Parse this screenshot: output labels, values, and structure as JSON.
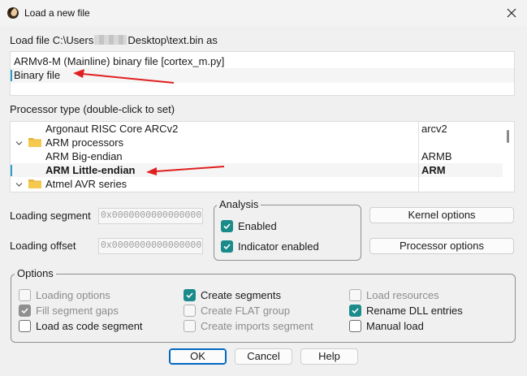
{
  "window": {
    "title": "Load a new file",
    "close_icon": "close-icon",
    "app_icon": "ida-app-icon"
  },
  "load_file": {
    "label_prefix": "Load file C:\\Users",
    "label_suffix": "Desktop\\text.bin as"
  },
  "file_types": [
    {
      "label": "ARMv8-M (Mainline) binary file [cortex_m.py]"
    },
    {
      "label": "Binary file",
      "selected": true
    }
  ],
  "processor": {
    "label": "Processor type (double-click to set)",
    "rows": [
      {
        "name": "Argonaut RISC Core ARCv2",
        "code": "arcv2"
      },
      {
        "name": "ARM processors",
        "code": "",
        "is_folder": true
      },
      {
        "name": "ARM Big-endian",
        "code": "ARMB"
      },
      {
        "name": "ARM Little-endian",
        "code": "ARM",
        "selected": true
      },
      {
        "name": "Atmel AVR series",
        "code": "",
        "is_folder": true
      }
    ]
  },
  "loading_segment": {
    "label": "Loading segment",
    "value": "0x0000000000000000"
  },
  "loading_offset": {
    "label": "Loading offset",
    "value": "0x0000000000000000"
  },
  "analysis": {
    "title": "Analysis",
    "enabled": {
      "label": "Enabled",
      "checked": true
    },
    "indicator": {
      "label": "Indicator enabled",
      "checked": true
    }
  },
  "buttons": {
    "kernel_options": "Kernel options",
    "processor_options": "Processor options",
    "ok": "OK",
    "cancel": "Cancel",
    "help": "Help"
  },
  "options": {
    "title": "Options",
    "items": [
      {
        "label": "Loading options",
        "checked": false,
        "disabled": true
      },
      {
        "label": "Fill segment gaps",
        "checked": true,
        "disabled": true
      },
      {
        "label": "Load as code segment",
        "checked": false,
        "disabled": false
      },
      {
        "label": "Create segments",
        "checked": true,
        "disabled": false
      },
      {
        "label": "Create FLAT group",
        "checked": false,
        "disabled": true
      },
      {
        "label": "Create imports segment",
        "checked": false,
        "disabled": true
      },
      {
        "label": "Load resources",
        "checked": false,
        "disabled": true
      },
      {
        "label": "Rename DLL entries",
        "checked": true,
        "disabled": false
      },
      {
        "label": "Manual load",
        "checked": false,
        "disabled": false
      }
    ]
  },
  "colors": {
    "checkbox_checked": "#1b8a8a",
    "annotation_arrow": "#e02020",
    "default_button_border": "#0067c0"
  }
}
